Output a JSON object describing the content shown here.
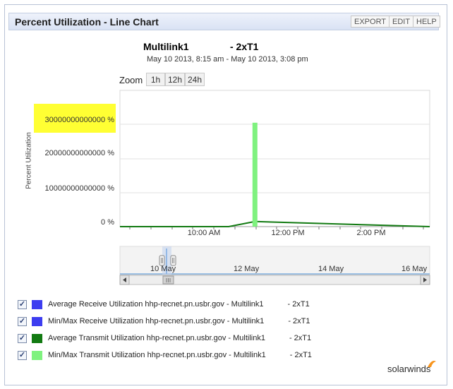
{
  "header": {
    "title": "Percent Utilization - Line Chart",
    "buttons": {
      "export": "EXPORT",
      "edit": "EDIT",
      "help": "HELP"
    }
  },
  "chart_header": {
    "title_left": "Multilink1",
    "title_right": "- 2xT1",
    "subtitle": "May 10 2013, 8:15 am - May 10 2013, 3:08 pm"
  },
  "zoom": {
    "label": "Zoom",
    "options": [
      "1h",
      "12h",
      "24h"
    ]
  },
  "navigator": {
    "labels": [
      "10 May",
      "12 May",
      "14 May",
      "16 May"
    ]
  },
  "colors": {
    "avg_receive": "#3d3df0",
    "minmax_receive": "#3d3df0",
    "avg_transmit": "#127a12",
    "minmax_transmit": "#7ff27f",
    "highlight": "#ffff33"
  },
  "chart_data": {
    "type": "line",
    "ylabel": "Percent Utilization",
    "yticks": [
      "0 %",
      "10000000000000 %",
      "20000000000000 %",
      "30000000000000 %"
    ],
    "ylim": [
      0,
      40000000000000
    ],
    "xticks": [
      "10:00 AM",
      "12:00 PM",
      "2:00 PM"
    ],
    "x_range": [
      "8:15 AM",
      "3:08 PM"
    ],
    "grid": true,
    "series": [
      {
        "name": "Average Transmit Utilization",
        "x": [
          "8:15 AM",
          "10:40 AM",
          "11:15 AM",
          "3:08 PM"
        ],
        "values": [
          0,
          0,
          1500000000000,
          0
        ]
      },
      {
        "name": "Min/Max Transmit Utilization",
        "x": [
          "11:15 AM"
        ],
        "values": [
          30500000000000
        ]
      }
    ]
  },
  "legend": [
    {
      "label": "Average Receive Utilization hhp-recnet.pn.usbr.gov - Multilink1",
      "suffix": "- 2xT1",
      "checked": "✓",
      "color": "#3d3df0"
    },
    {
      "label": "Min/Max Receive Utilization hhp-recnet.pn.usbr.gov - Multilink1",
      "suffix": "- 2xT1",
      "checked": "✓",
      "color": "#3d3df0"
    },
    {
      "label": "Average Transmit Utilization hhp-recnet.pn.usbr.gov - Multilink1",
      "suffix": "- 2xT1",
      "checked": "✓",
      "color": "#127a12"
    },
    {
      "label": "Min/Max Transmit Utilization hhp-recnet.pn.usbr.gov - Multilink1",
      "suffix": "- 2xT1",
      "checked": "✓",
      "color": "#7ff27f"
    }
  ],
  "branding": {
    "logo": "solarwinds"
  }
}
